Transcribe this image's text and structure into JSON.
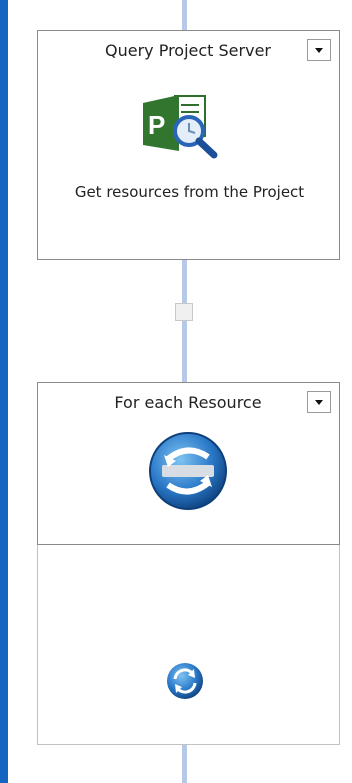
{
  "actions": [
    {
      "title": "Query Project Server",
      "description": "Get resources from the Project",
      "icon": "project-server-query-icon"
    },
    {
      "title": "For each Resource",
      "icon": "loop-icon"
    }
  ],
  "loop_body": {
    "icon": "loop-end-icon"
  },
  "colors": {
    "left_border": "#1565c0",
    "connector": "#b7c8e8",
    "project_green": "#31752f",
    "loop_blue": "#2a78c8"
  }
}
